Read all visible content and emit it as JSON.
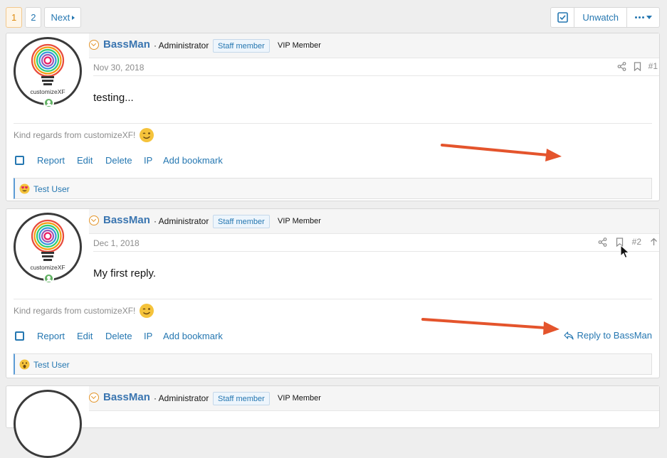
{
  "pagination": {
    "pages": [
      "1",
      "2"
    ],
    "current": "1",
    "next_label": "Next"
  },
  "thread_actions": {
    "unwatch_label": "Unwatch"
  },
  "posts": [
    {
      "avatar_text": "customizeXF",
      "username": "BassMan",
      "user_title": "· Administrator",
      "banner": "Staff member",
      "banner2": "VIP Member",
      "date": "Nov 30, 2018",
      "number": "#1",
      "body": "testing...",
      "signature": "Kind regards from customizeXF!",
      "controls": [
        "Report",
        "Edit",
        "Delete",
        "IP",
        "Add bookmark"
      ],
      "reaction_user": "Test User",
      "reply_label": ""
    },
    {
      "avatar_text": "customizeXF",
      "username": "BassMan",
      "user_title": "· Administrator",
      "banner": "Staff member",
      "banner2": "VIP Member",
      "date": "Dec 1, 2018",
      "number": "#2",
      "body": "My first reply.",
      "signature": "Kind regards from customizeXF!",
      "controls": [
        "Report",
        "Edit",
        "Delete",
        "IP",
        "Add bookmark"
      ],
      "reaction_user": "Test User",
      "reply_label": "Reply to BassMan"
    },
    {
      "avatar_text": "",
      "username": "BassMan",
      "user_title": "· Administrator",
      "banner": "Staff member",
      "banner2": "VIP Member"
    }
  ],
  "colors": {
    "link": "#2577b1",
    "username": "#3a75b0",
    "annotation_arrow": "#e4542c",
    "accent_orange": "#e3952b"
  }
}
